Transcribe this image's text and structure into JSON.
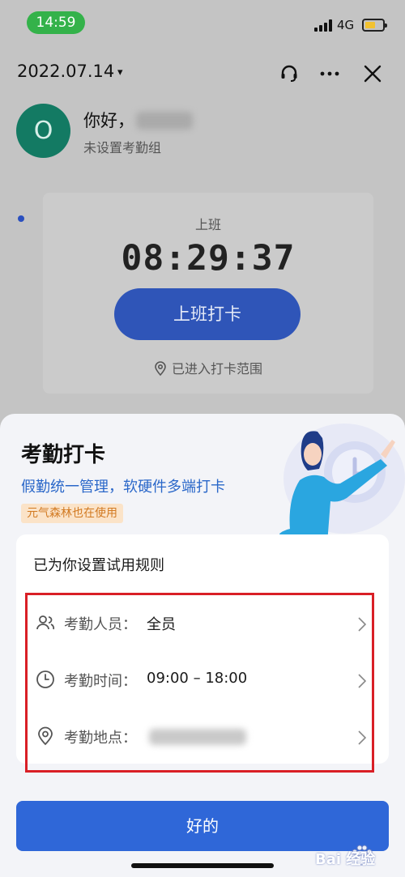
{
  "status_bar": {
    "time": "14:59",
    "network": "4G",
    "battery_color": "#f2c230"
  },
  "header": {
    "date": "2022.07.14",
    "caret": "▾"
  },
  "profile": {
    "avatar_letter": "O",
    "greeting": "你好，",
    "group_status": "未设置考勤组"
  },
  "clock_card": {
    "shift_label": "上班",
    "time": "08:29:37",
    "button_label": "上班打卡",
    "range_status": "已进入打卡范围"
  },
  "sheet": {
    "title": "考勤打卡",
    "subtitle": "假勤统一管理，软硬件多端打卡",
    "badge": "元气森林也在使用",
    "rules_heading": "已为你设置试用规则",
    "rules": [
      {
        "label": "考勤人员：",
        "value": "全员",
        "icon": "people-icon"
      },
      {
        "label": "考勤时间：",
        "value": "09:00 – 18:00",
        "icon": "clock-icon"
      },
      {
        "label": "考勤地点：",
        "value": "",
        "icon": "location-pin-icon"
      }
    ],
    "ok_button": "好的"
  },
  "watermark": {
    "text": "Bai 经验"
  },
  "colors": {
    "accent_blue": "#2f67d8",
    "highlight_red": "#d91f26",
    "avatar_green": "#137a63",
    "status_green": "#34b24a"
  }
}
